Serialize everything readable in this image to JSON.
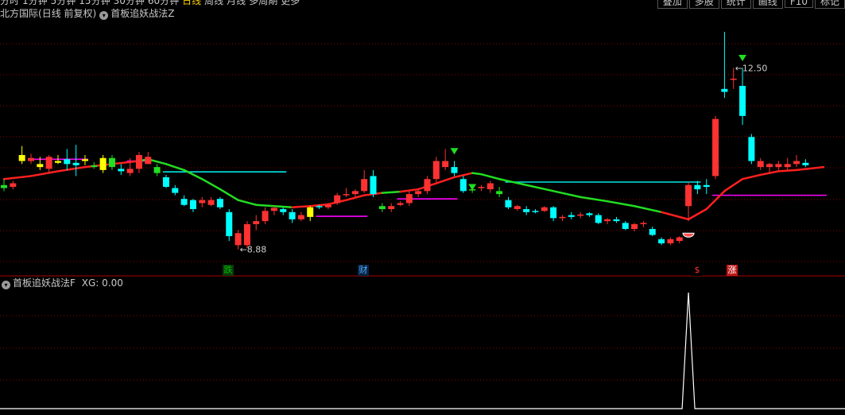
{
  "top_toolbar": {
    "periods": [
      "分时",
      "1分钟",
      "5分钟",
      "15分钟",
      "30分钟",
      "60分钟",
      "日线",
      "周线",
      "月线",
      "多周期",
      "更多"
    ],
    "active_period": "日线",
    "tools": [
      "叠加",
      "多股",
      "统计",
      "画线",
      "F10",
      "标记"
    ]
  },
  "main_panel": {
    "stock_name": "北方国际",
    "period_desc": "(日线 前复权)",
    "indicator_name": "首板追妖战法Z",
    "high_label": "12.50",
    "low_label": "8.88",
    "markers": [
      {
        "text": "跌",
        "color": "#00c000",
        "bg": "#0a3a0a"
      },
      {
        "text": "财",
        "color": "#4da6ff",
        "bg": "#0a2440"
      },
      {
        "text": "$",
        "color": "#ff3333",
        "bg": "#000000"
      },
      {
        "text": "涨",
        "color": "#ffffff",
        "bg": "#c01818"
      }
    ]
  },
  "sub_panel": {
    "indicator_name": "首板追妖战法F",
    "xg_label": "XG:",
    "xg_value": "0.00"
  },
  "colors": {
    "up": "#ff3232",
    "down": "#00ffff",
    "yellow": "#ffff00",
    "green_candle": "#22e022",
    "ma_red": "#ff2020",
    "ma_green": "#22dd22",
    "cyan_line": "#00e5e5",
    "magenta_line": "#ff00ff",
    "grid": "#8b0000"
  },
  "chart_data": {
    "type": "candlestick",
    "title": "",
    "price_range": [
      8.5,
      12.8
    ],
    "candles": [
      {
        "o": 9.95,
        "h": 10.05,
        "l": 9.85,
        "c": 9.9,
        "k": "g"
      },
      {
        "o": 9.92,
        "h": 10.02,
        "l": 9.88,
        "c": 9.98,
        "k": "u"
      },
      {
        "o": 10.45,
        "h": 10.6,
        "l": 10.3,
        "c": 10.35,
        "k": "y"
      },
      {
        "o": 10.4,
        "h": 10.47,
        "l": 10.3,
        "c": 10.35,
        "k": "u"
      },
      {
        "o": 10.3,
        "h": 10.42,
        "l": 10.2,
        "c": 10.25,
        "k": "y"
      },
      {
        "o": 10.22,
        "h": 10.45,
        "l": 10.15,
        "c": 10.42,
        "k": "u"
      },
      {
        "o": 10.35,
        "h": 10.45,
        "l": 10.3,
        "c": 10.32,
        "k": "y"
      },
      {
        "o": 10.38,
        "h": 10.55,
        "l": 10.2,
        "c": 10.3,
        "k": "d"
      },
      {
        "o": 10.32,
        "h": 10.62,
        "l": 10.1,
        "c": 10.28,
        "k": "d"
      },
      {
        "o": 10.35,
        "h": 10.45,
        "l": 10.28,
        "c": 10.38,
        "k": "y"
      },
      {
        "o": 10.28,
        "h": 10.33,
        "l": 10.22,
        "c": 10.25,
        "k": "g"
      },
      {
        "o": 10.2,
        "h": 10.45,
        "l": 10.15,
        "c": 10.4,
        "k": "y"
      },
      {
        "o": 10.4,
        "h": 10.45,
        "l": 10.2,
        "c": 10.25,
        "k": "g"
      },
      {
        "o": 10.22,
        "h": 10.3,
        "l": 10.12,
        "c": 10.18,
        "k": "d"
      },
      {
        "o": 10.15,
        "h": 10.4,
        "l": 10.1,
        "c": 10.22,
        "k": "u"
      },
      {
        "o": 10.22,
        "h": 10.5,
        "l": 10.15,
        "c": 10.45,
        "k": "u"
      },
      {
        "o": 10.42,
        "h": 10.5,
        "l": 10.32,
        "c": 10.3,
        "k": "u"
      },
      {
        "o": 10.25,
        "h": 10.3,
        "l": 10.1,
        "c": 10.15,
        "k": "g"
      },
      {
        "o": 10.08,
        "h": 10.12,
        "l": 9.9,
        "c": 9.92,
        "k": "d"
      },
      {
        "o": 9.9,
        "h": 9.95,
        "l": 9.78,
        "c": 9.82,
        "k": "d"
      },
      {
        "o": 9.72,
        "h": 9.78,
        "l": 9.6,
        "c": 9.62,
        "k": "d"
      },
      {
        "o": 9.7,
        "h": 9.72,
        "l": 9.5,
        "c": 9.55,
        "k": "d"
      },
      {
        "o": 9.65,
        "h": 9.75,
        "l": 9.58,
        "c": 9.7,
        "k": "u"
      },
      {
        "o": 9.62,
        "h": 9.75,
        "l": 9.6,
        "c": 9.7,
        "k": "u"
      },
      {
        "o": 9.72,
        "h": 9.75,
        "l": 9.55,
        "c": 9.58,
        "k": "d"
      },
      {
        "o": 9.5,
        "h": 9.55,
        "l": 9.02,
        "c": 9.1,
        "k": "d"
      },
      {
        "o": 9.15,
        "h": 9.2,
        "l": 8.88,
        "c": 8.95,
        "k": "u"
      },
      {
        "o": 8.95,
        "h": 9.35,
        "l": 8.9,
        "c": 9.3,
        "k": "u"
      },
      {
        "o": 9.3,
        "h": 9.45,
        "l": 9.2,
        "c": 9.35,
        "k": "u"
      },
      {
        "o": 9.35,
        "h": 9.58,
        "l": 9.3,
        "c": 9.52,
        "k": "u"
      },
      {
        "o": 9.52,
        "h": 9.6,
        "l": 9.45,
        "c": 9.57,
        "k": "u"
      },
      {
        "o": 9.55,
        "h": 9.58,
        "l": 9.45,
        "c": 9.5,
        "k": "d"
      },
      {
        "o": 9.5,
        "h": 9.55,
        "l": 9.32,
        "c": 9.38,
        "k": "d"
      },
      {
        "o": 9.38,
        "h": 9.5,
        "l": 9.35,
        "c": 9.45,
        "k": "u"
      },
      {
        "o": 9.42,
        "h": 9.6,
        "l": 9.35,
        "c": 9.58,
        "k": "y"
      },
      {
        "o": 9.58,
        "h": 9.62,
        "l": 9.55,
        "c": 9.6,
        "k": "d"
      },
      {
        "o": 9.58,
        "h": 9.65,
        "l": 9.55,
        "c": 9.62,
        "k": "u"
      },
      {
        "o": 9.65,
        "h": 9.82,
        "l": 9.62,
        "c": 9.78,
        "k": "u"
      },
      {
        "o": 9.78,
        "h": 9.9,
        "l": 9.75,
        "c": 9.8,
        "k": "u"
      },
      {
        "o": 9.8,
        "h": 9.88,
        "l": 9.75,
        "c": 9.85,
        "k": "u"
      },
      {
        "o": 9.85,
        "h": 10.2,
        "l": 9.82,
        "c": 10.05,
        "k": "u"
      },
      {
        "o": 10.1,
        "h": 10.2,
        "l": 9.75,
        "c": 9.8,
        "k": "d"
      },
      {
        "o": 9.6,
        "h": 9.65,
        "l": 9.5,
        "c": 9.55,
        "k": "g"
      },
      {
        "o": 9.55,
        "h": 9.65,
        "l": 9.5,
        "c": 9.6,
        "k": "u"
      },
      {
        "o": 9.62,
        "h": 9.68,
        "l": 9.6,
        "c": 9.65,
        "k": "u"
      },
      {
        "o": 9.65,
        "h": 9.85,
        "l": 9.6,
        "c": 9.8,
        "k": "u"
      },
      {
        "o": 9.8,
        "h": 9.88,
        "l": 9.75,
        "c": 9.85,
        "k": "u"
      },
      {
        "o": 9.85,
        "h": 10.1,
        "l": 9.8,
        "c": 10.05,
        "k": "u"
      },
      {
        "o": 10.05,
        "h": 10.42,
        "l": 10.0,
        "c": 10.35,
        "k": "u"
      },
      {
        "o": 10.35,
        "h": 10.55,
        "l": 10.2,
        "c": 10.25,
        "k": "u"
      },
      {
        "o": 10.25,
        "h": 10.35,
        "l": 10.1,
        "c": 10.15,
        "k": "d"
      },
      {
        "o": 10.05,
        "h": 10.1,
        "l": 9.82,
        "c": 9.85,
        "k": "d"
      },
      {
        "o": 9.88,
        "h": 9.9,
        "l": 9.82,
        "c": 9.88,
        "k": "g"
      },
      {
        "o": 9.9,
        "h": 9.95,
        "l": 9.85,
        "c": 9.92,
        "k": "u"
      },
      {
        "o": 9.88,
        "h": 10.02,
        "l": 9.82,
        "c": 9.98,
        "k": "u"
      },
      {
        "o": 9.85,
        "h": 9.92,
        "l": 9.75,
        "c": 9.8,
        "k": "g"
      },
      {
        "o": 9.7,
        "h": 9.75,
        "l": 9.55,
        "c": 9.58,
        "k": "d"
      },
      {
        "o": 9.6,
        "h": 9.62,
        "l": 9.52,
        "c": 9.55,
        "k": "u"
      },
      {
        "o": 9.55,
        "h": 9.6,
        "l": 9.45,
        "c": 9.5,
        "k": "d"
      },
      {
        "o": 9.5,
        "h": 9.55,
        "l": 9.48,
        "c": 9.52,
        "k": "d"
      },
      {
        "o": 9.52,
        "h": 9.6,
        "l": 9.5,
        "c": 9.58,
        "k": "u"
      },
      {
        "o": 9.58,
        "h": 9.6,
        "l": 9.35,
        "c": 9.4,
        "k": "d"
      },
      {
        "o": 9.4,
        "h": 9.45,
        "l": 9.35,
        "c": 9.42,
        "k": "u"
      },
      {
        "o": 9.42,
        "h": 9.5,
        "l": 9.38,
        "c": 9.45,
        "k": "d"
      },
      {
        "o": 9.45,
        "h": 9.5,
        "l": 9.4,
        "c": 9.46,
        "k": "u"
      },
      {
        "o": 9.45,
        "h": 9.5,
        "l": 9.42,
        "c": 9.48,
        "k": "d"
      },
      {
        "o": 9.45,
        "h": 9.48,
        "l": 9.3,
        "c": 9.32,
        "k": "d"
      },
      {
        "o": 9.35,
        "h": 9.4,
        "l": 9.3,
        "c": 9.38,
        "k": "u"
      },
      {
        "o": 9.38,
        "h": 9.42,
        "l": 9.32,
        "c": 9.35,
        "k": "d"
      },
      {
        "o": 9.32,
        "h": 9.35,
        "l": 9.2,
        "c": 9.22,
        "k": "d"
      },
      {
        "o": 9.22,
        "h": 9.32,
        "l": 9.18,
        "c": 9.3,
        "k": "u"
      },
      {
        "o": 9.3,
        "h": 9.35,
        "l": 9.25,
        "c": 9.32,
        "k": "u"
      },
      {
        "o": 9.22,
        "h": 9.26,
        "l": 9.1,
        "c": 9.12,
        "k": "d"
      },
      {
        "o": 9.05,
        "h": 9.08,
        "l": 8.95,
        "c": 8.98,
        "k": "d"
      },
      {
        "o": 8.98,
        "h": 9.08,
        "l": 8.95,
        "c": 9.05,
        "k": "u"
      },
      {
        "o": 9.02,
        "h": 9.1,
        "l": 8.98,
        "c": 9.08,
        "k": "u"
      },
      {
        "o": 9.6,
        "h": 10.0,
        "l": 9.35,
        "c": 9.95,
        "k": "u"
      },
      {
        "o": 9.95,
        "h": 10.02,
        "l": 9.8,
        "c": 9.88,
        "k": "d"
      },
      {
        "o": 9.92,
        "h": 10.05,
        "l": 9.8,
        "c": 9.95,
        "k": "d"
      },
      {
        "o": 10.1,
        "h": 11.1,
        "l": 10.05,
        "c": 11.05,
        "k": "u"
      },
      {
        "o": 11.55,
        "h": 12.5,
        "l": 11.4,
        "c": 11.5,
        "k": "d"
      },
      {
        "o": 11.7,
        "h": 11.9,
        "l": 11.55,
        "c": 11.72,
        "k": "u"
      },
      {
        "o": 11.6,
        "h": 11.9,
        "l": 10.95,
        "c": 11.1,
        "k": "d"
      },
      {
        "o": 10.75,
        "h": 10.8,
        "l": 10.3,
        "c": 10.35,
        "k": "d"
      },
      {
        "o": 10.35,
        "h": 10.4,
        "l": 10.2,
        "c": 10.25,
        "k": "u"
      },
      {
        "o": 10.25,
        "h": 10.32,
        "l": 10.15,
        "c": 10.3,
        "k": "u"
      },
      {
        "o": 10.25,
        "h": 10.35,
        "l": 10.2,
        "c": 10.3,
        "k": "u"
      },
      {
        "o": 10.25,
        "h": 10.4,
        "l": 10.2,
        "c": 10.3,
        "k": "u"
      },
      {
        "o": 10.3,
        "h": 10.45,
        "l": 10.25,
        "c": 10.35,
        "k": "u"
      },
      {
        "o": 10.32,
        "h": 10.38,
        "l": 10.25,
        "c": 10.28,
        "k": "d"
      }
    ],
    "ma_points": [
      [
        0,
        10.05,
        "r"
      ],
      [
        3,
        10.1,
        "r"
      ],
      [
        6,
        10.18,
        "r"
      ],
      [
        9,
        10.25,
        "r"
      ],
      [
        12,
        10.3,
        "r"
      ],
      [
        15,
        10.35,
        "r"
      ],
      [
        16,
        10.38,
        "g"
      ],
      [
        18,
        10.3,
        "g"
      ],
      [
        20,
        10.2,
        "g"
      ],
      [
        22,
        10.05,
        "g"
      ],
      [
        24,
        9.88,
        "g"
      ],
      [
        26,
        9.7,
        "g"
      ],
      [
        28,
        9.62,
        "g"
      ],
      [
        30,
        9.6,
        "g"
      ],
      [
        32,
        9.58,
        "g"
      ],
      [
        34,
        9.6,
        "r"
      ],
      [
        36,
        9.63,
        "r"
      ],
      [
        38,
        9.7,
        "r"
      ],
      [
        40,
        9.78,
        "r"
      ],
      [
        42,
        9.82,
        "r"
      ],
      [
        44,
        9.84,
        "g"
      ],
      [
        46,
        9.88,
        "r"
      ],
      [
        48,
        9.98,
        "r"
      ],
      [
        50,
        10.08,
        "r"
      ],
      [
        52,
        10.15,
        "r"
      ],
      [
        53,
        10.13,
        "g"
      ],
      [
        55,
        10.05,
        "g"
      ],
      [
        58,
        9.95,
        "g"
      ],
      [
        61,
        9.85,
        "g"
      ],
      [
        64,
        9.75,
        "g"
      ],
      [
        67,
        9.68,
        "g"
      ],
      [
        70,
        9.6,
        "g"
      ],
      [
        73,
        9.5,
        "g"
      ],
      [
        76,
        9.38,
        "r"
      ],
      [
        78,
        9.55,
        "r"
      ],
      [
        80,
        9.85,
        "r"
      ],
      [
        82,
        10.05,
        "r"
      ],
      [
        84,
        10.12,
        "r"
      ],
      [
        86,
        10.18,
        "r"
      ],
      [
        88,
        10.2,
        "r"
      ],
      [
        91,
        10.25,
        "r"
      ]
    ],
    "horizontal_lines": [
      {
        "from": 3,
        "to": 9,
        "price": 10.38,
        "color": "magenta"
      },
      {
        "from": 14,
        "to": 16,
        "price": 10.35,
        "color": "magenta"
      },
      {
        "from": 18,
        "to": 31,
        "price": 10.17,
        "color": "cyan"
      },
      {
        "from": 35,
        "to": 40,
        "price": 9.43,
        "color": "magenta"
      },
      {
        "from": 44,
        "to": 50,
        "price": 9.72,
        "color": "magenta"
      },
      {
        "from": 56,
        "to": 77,
        "price": 10.0,
        "color": "cyan"
      },
      {
        "from": 79,
        "to": 91,
        "price": 9.78,
        "color": "magenta"
      }
    ],
    "xg_signal": {
      "index": 76,
      "value": 1
    }
  }
}
